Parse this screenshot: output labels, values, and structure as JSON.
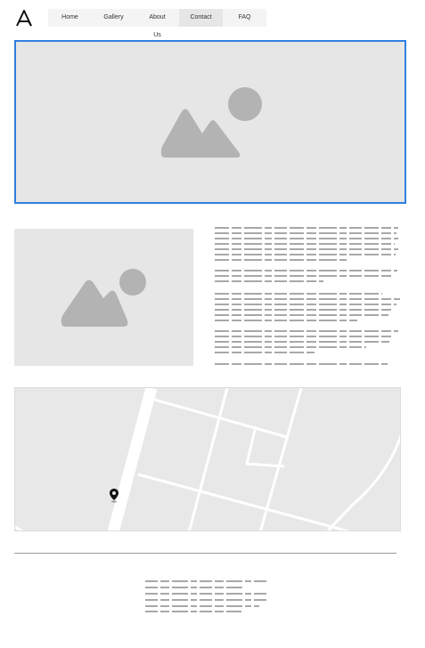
{
  "header": {
    "logo_icon": "logo-a-icon",
    "nav": [
      {
        "label": "Home",
        "active": false
      },
      {
        "label": "Gallery",
        "active": false
      },
      {
        "label": "About Us",
        "active": false
      },
      {
        "label": "Contact",
        "active": true
      },
      {
        "label": "FAQ",
        "active": false
      }
    ]
  },
  "hero": {
    "icon": "image-placeholder-icon",
    "selected": true,
    "accent_color": "#2f80e0"
  },
  "content": {
    "image_icon": "image-placeholder-icon",
    "text_placeholder": "greeked-text-lines"
  },
  "map": {
    "icon": "map-pin-icon"
  },
  "footer": {
    "text_placeholder": "greeked-text-lines"
  },
  "colors": {
    "placeholder_bg": "#e6e6e6",
    "placeholder_shape": "#b3b3b3",
    "text_line": "#8c8c8c"
  }
}
